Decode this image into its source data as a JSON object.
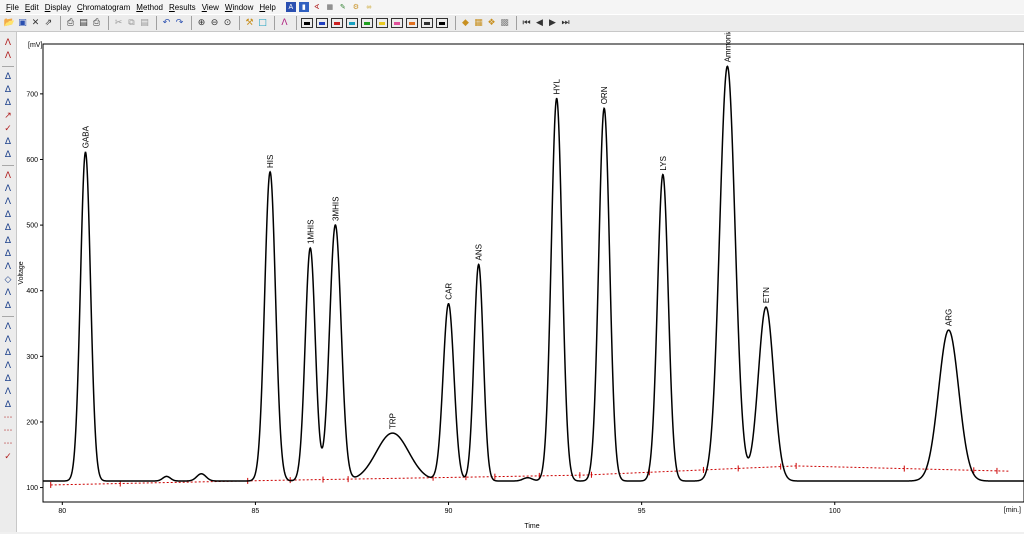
{
  "menu": {
    "items": [
      "File",
      "Edit",
      "Display",
      "Chromatogram",
      "Method",
      "Results",
      "View",
      "Window",
      "Help"
    ]
  },
  "toolbar": {
    "icons": [
      "open-icon",
      "save-icon",
      "close-icon",
      "export-icon",
      "print-icon",
      "print-preview-icon",
      "cut-icon",
      "copy-icon",
      "paste-icon",
      "undo-icon",
      "redo-icon",
      "zoom-in-icon",
      "zoom-out-icon",
      "zoom-fit-icon",
      "tools-icon",
      "comment-icon",
      "peak-icon",
      "first-icon",
      "prev-icon",
      "next-icon",
      "last-icon"
    ],
    "swatch_colors": [
      "#000000",
      "#1f3fbf",
      "#cc2020",
      "#18a0c0",
      "#20a020",
      "#e8c820",
      "#e0509a",
      "#e07020",
      "#303030",
      "#000000"
    ]
  },
  "colors": {
    "trace": "#000000",
    "baseline": "#cc0000",
    "frame": "#000000"
  },
  "chart_data": {
    "type": "line",
    "xlabel": "Time",
    "ylabel": "Voltage",
    "x_unit": "[min.]",
    "y_unit": "[mV]",
    "xlim": [
      79.5,
      104.9
    ],
    "ylim": [
      78,
      776
    ],
    "x_ticks": [
      80,
      85,
      90,
      95,
      100
    ],
    "y_ticks": [
      100,
      200,
      300,
      400,
      500,
      600,
      700
    ],
    "base_level": 110,
    "peaks": [
      {
        "name": "GABA",
        "x": 80.6,
        "height": 611,
        "width": 0.13
      },
      {
        "name": "",
        "x": 82.7,
        "height": 117,
        "width": 0.1
      },
      {
        "name": "",
        "x": 83.6,
        "height": 121,
        "width": 0.12
      },
      {
        "name": "HIS",
        "x": 85.38,
        "height": 581,
        "width": 0.14
      },
      {
        "name": "1MHIS",
        "x": 86.42,
        "height": 465,
        "width": 0.13
      },
      {
        "name": "3MHIS",
        "x": 87.07,
        "height": 500,
        "width": 0.15
      },
      {
        "name": "TRP",
        "x": 88.55,
        "height": 183,
        "width": 0.42
      },
      {
        "name": "CAR",
        "x": 90.0,
        "height": 380,
        "width": 0.14
      },
      {
        "name": "ANS",
        "x": 90.78,
        "height": 440,
        "width": 0.12
      },
      {
        "name": "",
        "x": 92.05,
        "height": 115,
        "width": 0.12
      },
      {
        "name": "HYL",
        "x": 92.8,
        "height": 693,
        "width": 0.14
      },
      {
        "name": "ORN",
        "x": 94.03,
        "height": 678,
        "width": 0.14
      },
      {
        "name": "LYS",
        "x": 95.55,
        "height": 577,
        "width": 0.14
      },
      {
        "name": "Ammonia",
        "x": 97.22,
        "height": 742,
        "width": 0.2
      },
      {
        "name": "ETN",
        "x": 98.22,
        "height": 375,
        "width": 0.2
      },
      {
        "name": "ARG",
        "x": 102.95,
        "height": 340,
        "width": 0.26
      }
    ],
    "baseline": {
      "x": [
        79.7,
        85.5,
        89.6,
        93.5,
        99.0,
        104.5
      ],
      "y": [
        104,
        111,
        115,
        119,
        133,
        125
      ]
    },
    "markers": [
      79.7,
      81.5,
      84.8,
      85.9,
      86.75,
      87.4,
      89.6,
      90.45,
      91.2,
      92.35,
      93.4,
      93.7,
      95.2,
      96.6,
      97.5,
      98.6,
      99.0,
      101.8,
      103.6,
      104.2
    ]
  }
}
